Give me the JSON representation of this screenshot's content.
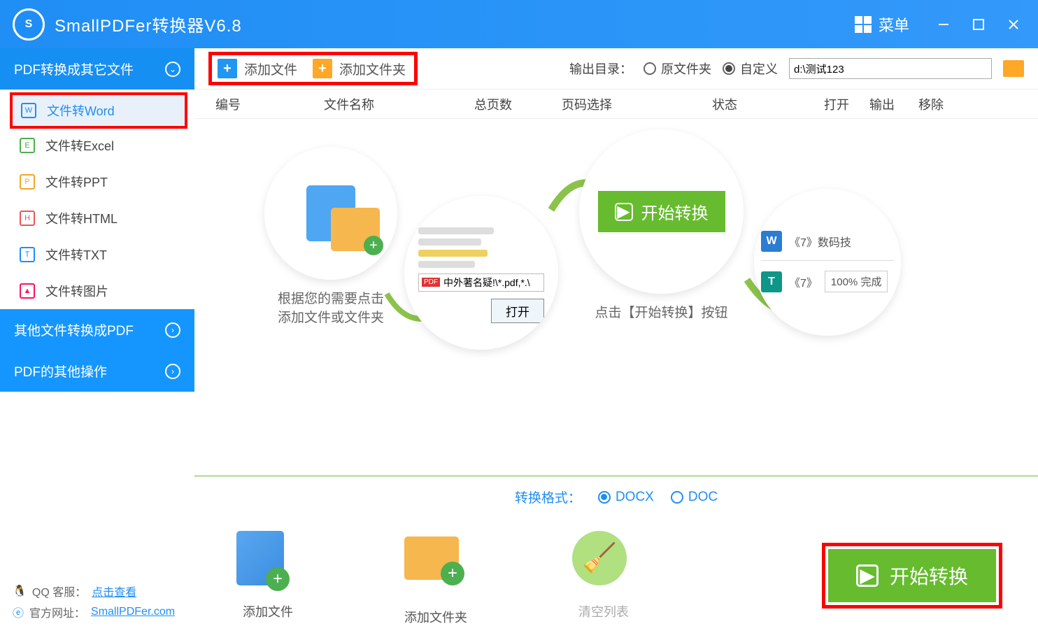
{
  "title": "SmallPDFer转换器V6.8",
  "menu_label": "菜单",
  "sidebar": {
    "header1": "PDF转换成其它文件",
    "header2": "其他文件转换成PDF",
    "header3": "PDF的其他操作",
    "items": [
      "文件转Word",
      "文件转Excel",
      "文件转PPT",
      "文件转HTML",
      "文件转TXT",
      "文件转图片"
    ]
  },
  "footer": {
    "qq_label": "QQ 客服：",
    "qq_link": "点击查看",
    "site_label": "官方网址：",
    "site_link": "SmallPDFer.com"
  },
  "toolbar": {
    "add_file": "添加文件",
    "add_folder": "添加文件夹",
    "out_label": "输出目录：",
    "opt_orig": "原文件夹",
    "opt_custom": "自定义",
    "path": "d:\\测试123"
  },
  "table_headers": {
    "num": "编号",
    "name": "文件名称",
    "pages": "总页数",
    "sel": "页码选择",
    "status": "状态",
    "open": "打开",
    "out": "输出",
    "del": "移除"
  },
  "guide": {
    "text1a": "根据您的需要点击",
    "text1b": "添加文件或文件夹",
    "popup_file": "中外著名疑!\\*.pdf,*.\\",
    "popup_open": "打开",
    "start_label": "开始转换",
    "text2": "点击【开始转换】按钮",
    "row1": "《7》数码技",
    "row2a": "《7》",
    "row2b": "100%  完成"
  },
  "format": {
    "label": "转换格式：",
    "opt1": "DOCX",
    "opt2": "DOC"
  },
  "bottom": {
    "add_file": "添加文件",
    "add_folder": "添加文件夹",
    "clear": "清空列表",
    "start": "开始转换"
  }
}
